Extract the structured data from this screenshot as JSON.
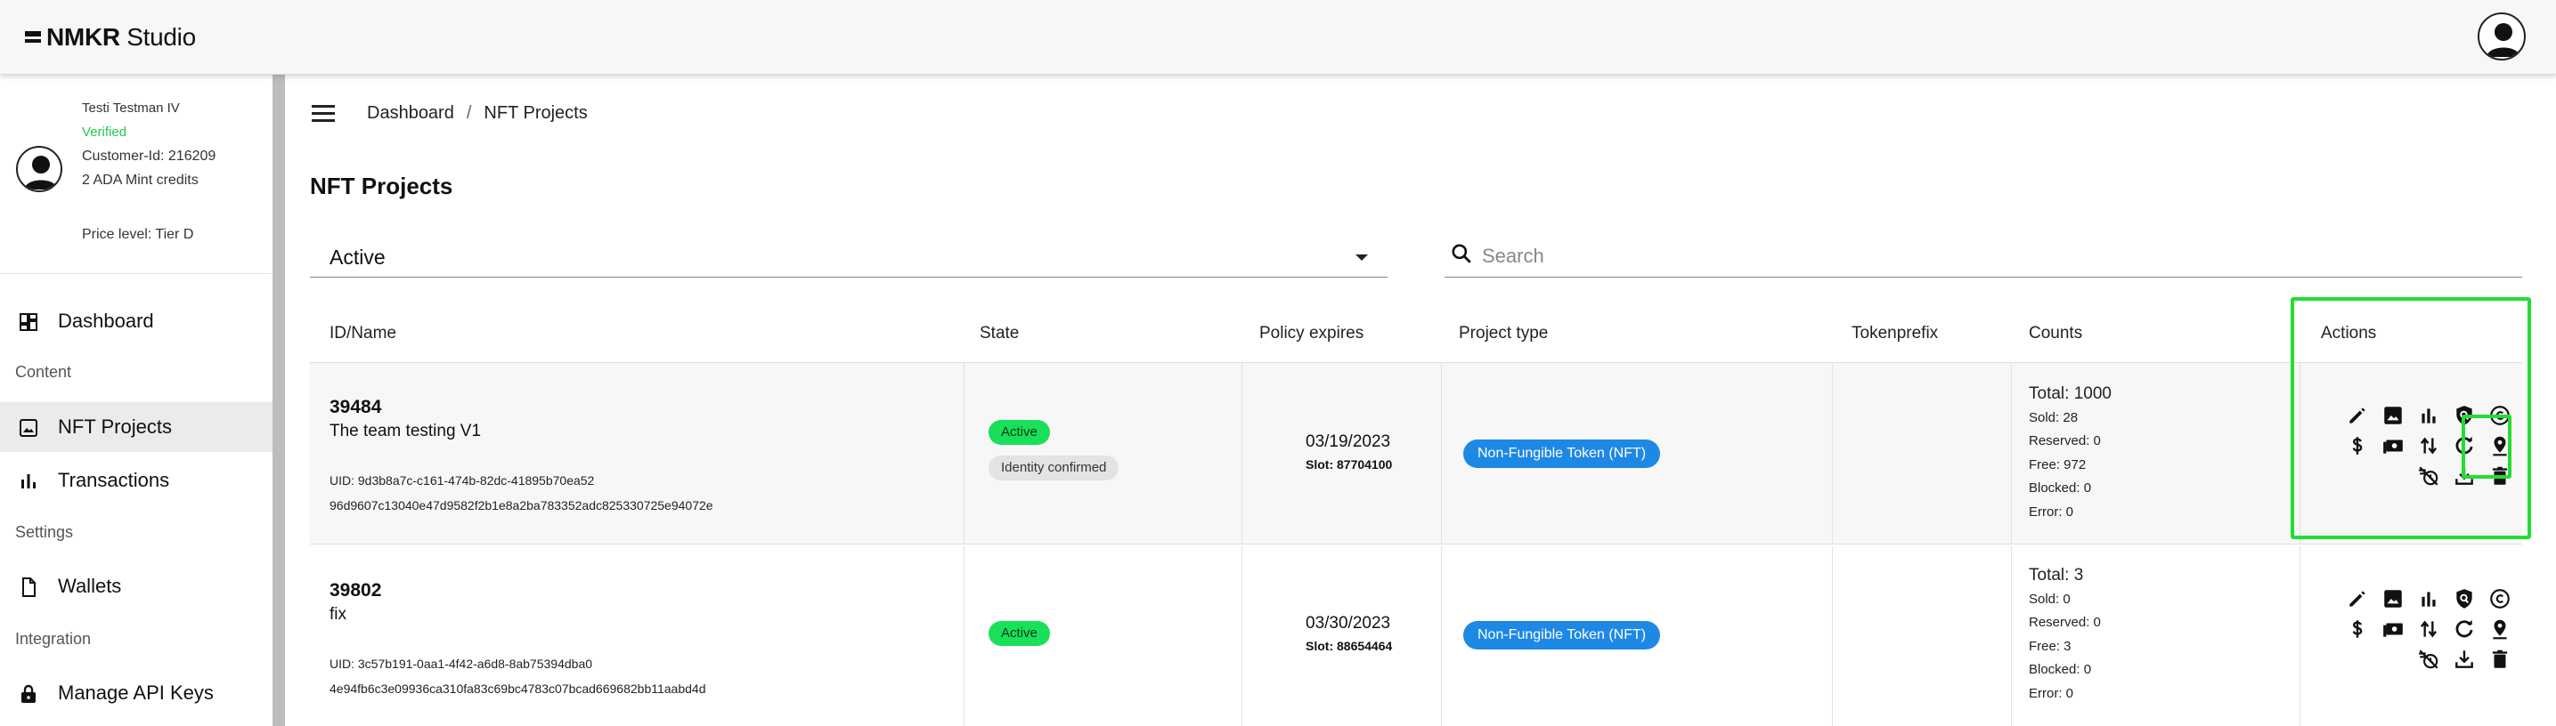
{
  "app": {
    "brand_bold": "NMKR",
    "brand_rest": " Studio"
  },
  "profile": {
    "name": "Testi Testman IV",
    "status": "Verified",
    "customer_id": "Customer-Id: 216209",
    "credits": "2 ADA Mint credits",
    "price_level": "Price level: Tier D"
  },
  "sidebar": {
    "dashboard": "Dashboard",
    "section_content": "Content",
    "nft_projects": "NFT Projects",
    "transactions": "Transactions",
    "section_settings": "Settings",
    "wallets": "Wallets",
    "section_integration": "Integration",
    "manage_api_keys": "Manage API Keys"
  },
  "breadcrumb": {
    "root": "Dashboard",
    "separator": "/",
    "current": "NFT Projects"
  },
  "page": {
    "title": "NFT Projects"
  },
  "filter": {
    "value": "Active"
  },
  "search": {
    "placeholder": "Search"
  },
  "table": {
    "headers": {
      "id_name": "ID/Name",
      "state": "State",
      "policy_expires": "Policy expires",
      "project_type": "Project type",
      "tokenprefix": "Tokenprefix",
      "counts": "Counts",
      "actions": "Actions"
    },
    "rows": [
      {
        "id": "39484",
        "name": "The team testing V1",
        "uid": "UID: 9d3b8a7c-c161-474b-82dc-41895b70ea52",
        "hash": "96d9607c13040e47d9582f2b1e8a2ba783352adc825330725e94072e",
        "state": "Active",
        "identity": "Identity confirmed",
        "policy_date": "03/19/2023",
        "policy_slot": "Slot: 87704100",
        "project_type": "Non-Fungible Token (NFT)",
        "tokenprefix": "",
        "total": "Total: 1000",
        "sold": "Sold: 28",
        "reserved": "Reserved: 0",
        "free": "Free: 972",
        "blocked": "Blocked: 0",
        "error": "Error: 0"
      },
      {
        "id": "39802",
        "name": "fix",
        "uid": "UID: 3c57b191-0aa1-4f42-a6d8-8ab75394dba0",
        "hash": "4e94fb6c3e09936ca310fa83c69bc4783c07bcad669682bb11aabd4d",
        "state": "Active",
        "policy_date": "03/30/2023",
        "policy_slot": "Slot: 88654464",
        "project_type": "Non-Fungible Token (NFT)",
        "tokenprefix": "",
        "total": "Total: 3",
        "sold": "Sold: 0",
        "reserved": "Reserved: 0",
        "free": "Free: 3",
        "blocked": "Blocked: 0",
        "error": "Error: 0"
      }
    ]
  },
  "action_icons": [
    "pencil-icon",
    "image-icon",
    "bar-chart-icon",
    "shield-search-icon",
    "copyright-icon",
    "dollar-icon",
    "payment-icon",
    "swap-icon",
    "refresh-icon",
    "location-pin-icon",
    "timer-off-icon",
    "download-icon",
    "trash-icon"
  ],
  "colors": {
    "active_badge": "#19e05a",
    "type_badge": "#1e88e5",
    "highlight": "#22dd33",
    "verified": "#1fc94a"
  }
}
